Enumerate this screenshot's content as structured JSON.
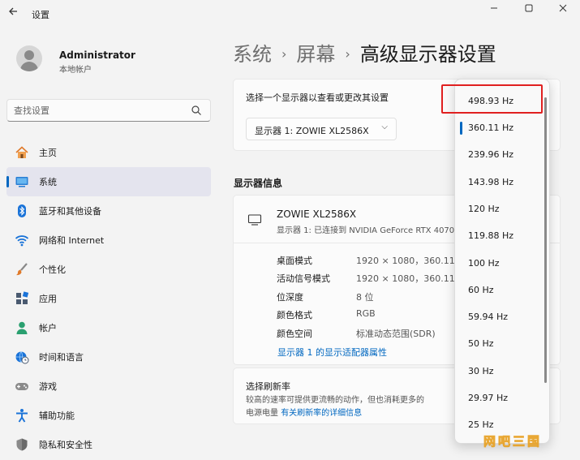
{
  "window": {
    "title": "设置",
    "controls": [
      "minimize-icon",
      "maximize-icon",
      "close-icon"
    ]
  },
  "account": {
    "name": "Administrator",
    "type": "本地帐户"
  },
  "search": {
    "placeholder": "查找设置"
  },
  "sidebar": {
    "items": [
      {
        "label": "主页",
        "icon": "home-icon"
      },
      {
        "label": "系统",
        "icon": "system-icon",
        "active": true
      },
      {
        "label": "蓝牙和其他设备",
        "icon": "bluetooth-icon"
      },
      {
        "label": "网络和 Internet",
        "icon": "wifi-icon"
      },
      {
        "label": "个性化",
        "icon": "brush-icon"
      },
      {
        "label": "应用",
        "icon": "apps-icon"
      },
      {
        "label": "帐户",
        "icon": "person-icon"
      },
      {
        "label": "时间和语言",
        "icon": "globe-clock-icon"
      },
      {
        "label": "游戏",
        "icon": "gamepad-icon"
      },
      {
        "label": "辅助功能",
        "icon": "accessibility-icon"
      },
      {
        "label": "隐私和安全性",
        "icon": "shield-icon"
      }
    ]
  },
  "breadcrumb": {
    "items": [
      "系统",
      "屏幕",
      "高级显示器设置"
    ],
    "separator": "›"
  },
  "display_select": {
    "label": "选择一个显示器以查看或更改其设置",
    "value": "显示器 1: ZOWIE XL2586X"
  },
  "display_info": {
    "section_title": "显示器信息",
    "monitor_name": "ZOWIE XL2586X",
    "monitor_sub": "显示器 1: 已连接到 NVIDIA GeForce RTX 4070",
    "properties": [
      {
        "label": "桌面模式",
        "value": "1920 × 1080，360.11 Hz"
      },
      {
        "label": "活动信号模式",
        "value": "1920 × 1080，360.11 Hz"
      },
      {
        "label": "位深度",
        "value": "8 位"
      },
      {
        "label": "颜色格式",
        "value": "RGB"
      },
      {
        "label": "颜色空间",
        "value": "标准动态范围(SDR)"
      }
    ],
    "adapter_link": "显示器 1 的显示适配器属性"
  },
  "refresh_rate": {
    "title": "选择刷新率",
    "desc_1": "较高的速率可提供更流畅的动作，但也消耗更多的",
    "desc_2": "电源电量",
    "link": "有关刷新率的详细信息",
    "options": [
      "498.93 Hz",
      "360.11 Hz",
      "239.96 Hz",
      "143.98 Hz",
      "120 Hz",
      "119.88 Hz",
      "100 Hz",
      "60 Hz",
      "59.94 Hz",
      "50 Hz",
      "30 Hz",
      "29.97 Hz",
      "25 Hz"
    ],
    "selected": "360.11 Hz",
    "highlighted": "498.93 Hz"
  },
  "colors": {
    "accent": "#0067c0",
    "highlight_box": "#e02020",
    "active_nav_bg": "#e4e4ee"
  },
  "watermark": "网吧三国"
}
